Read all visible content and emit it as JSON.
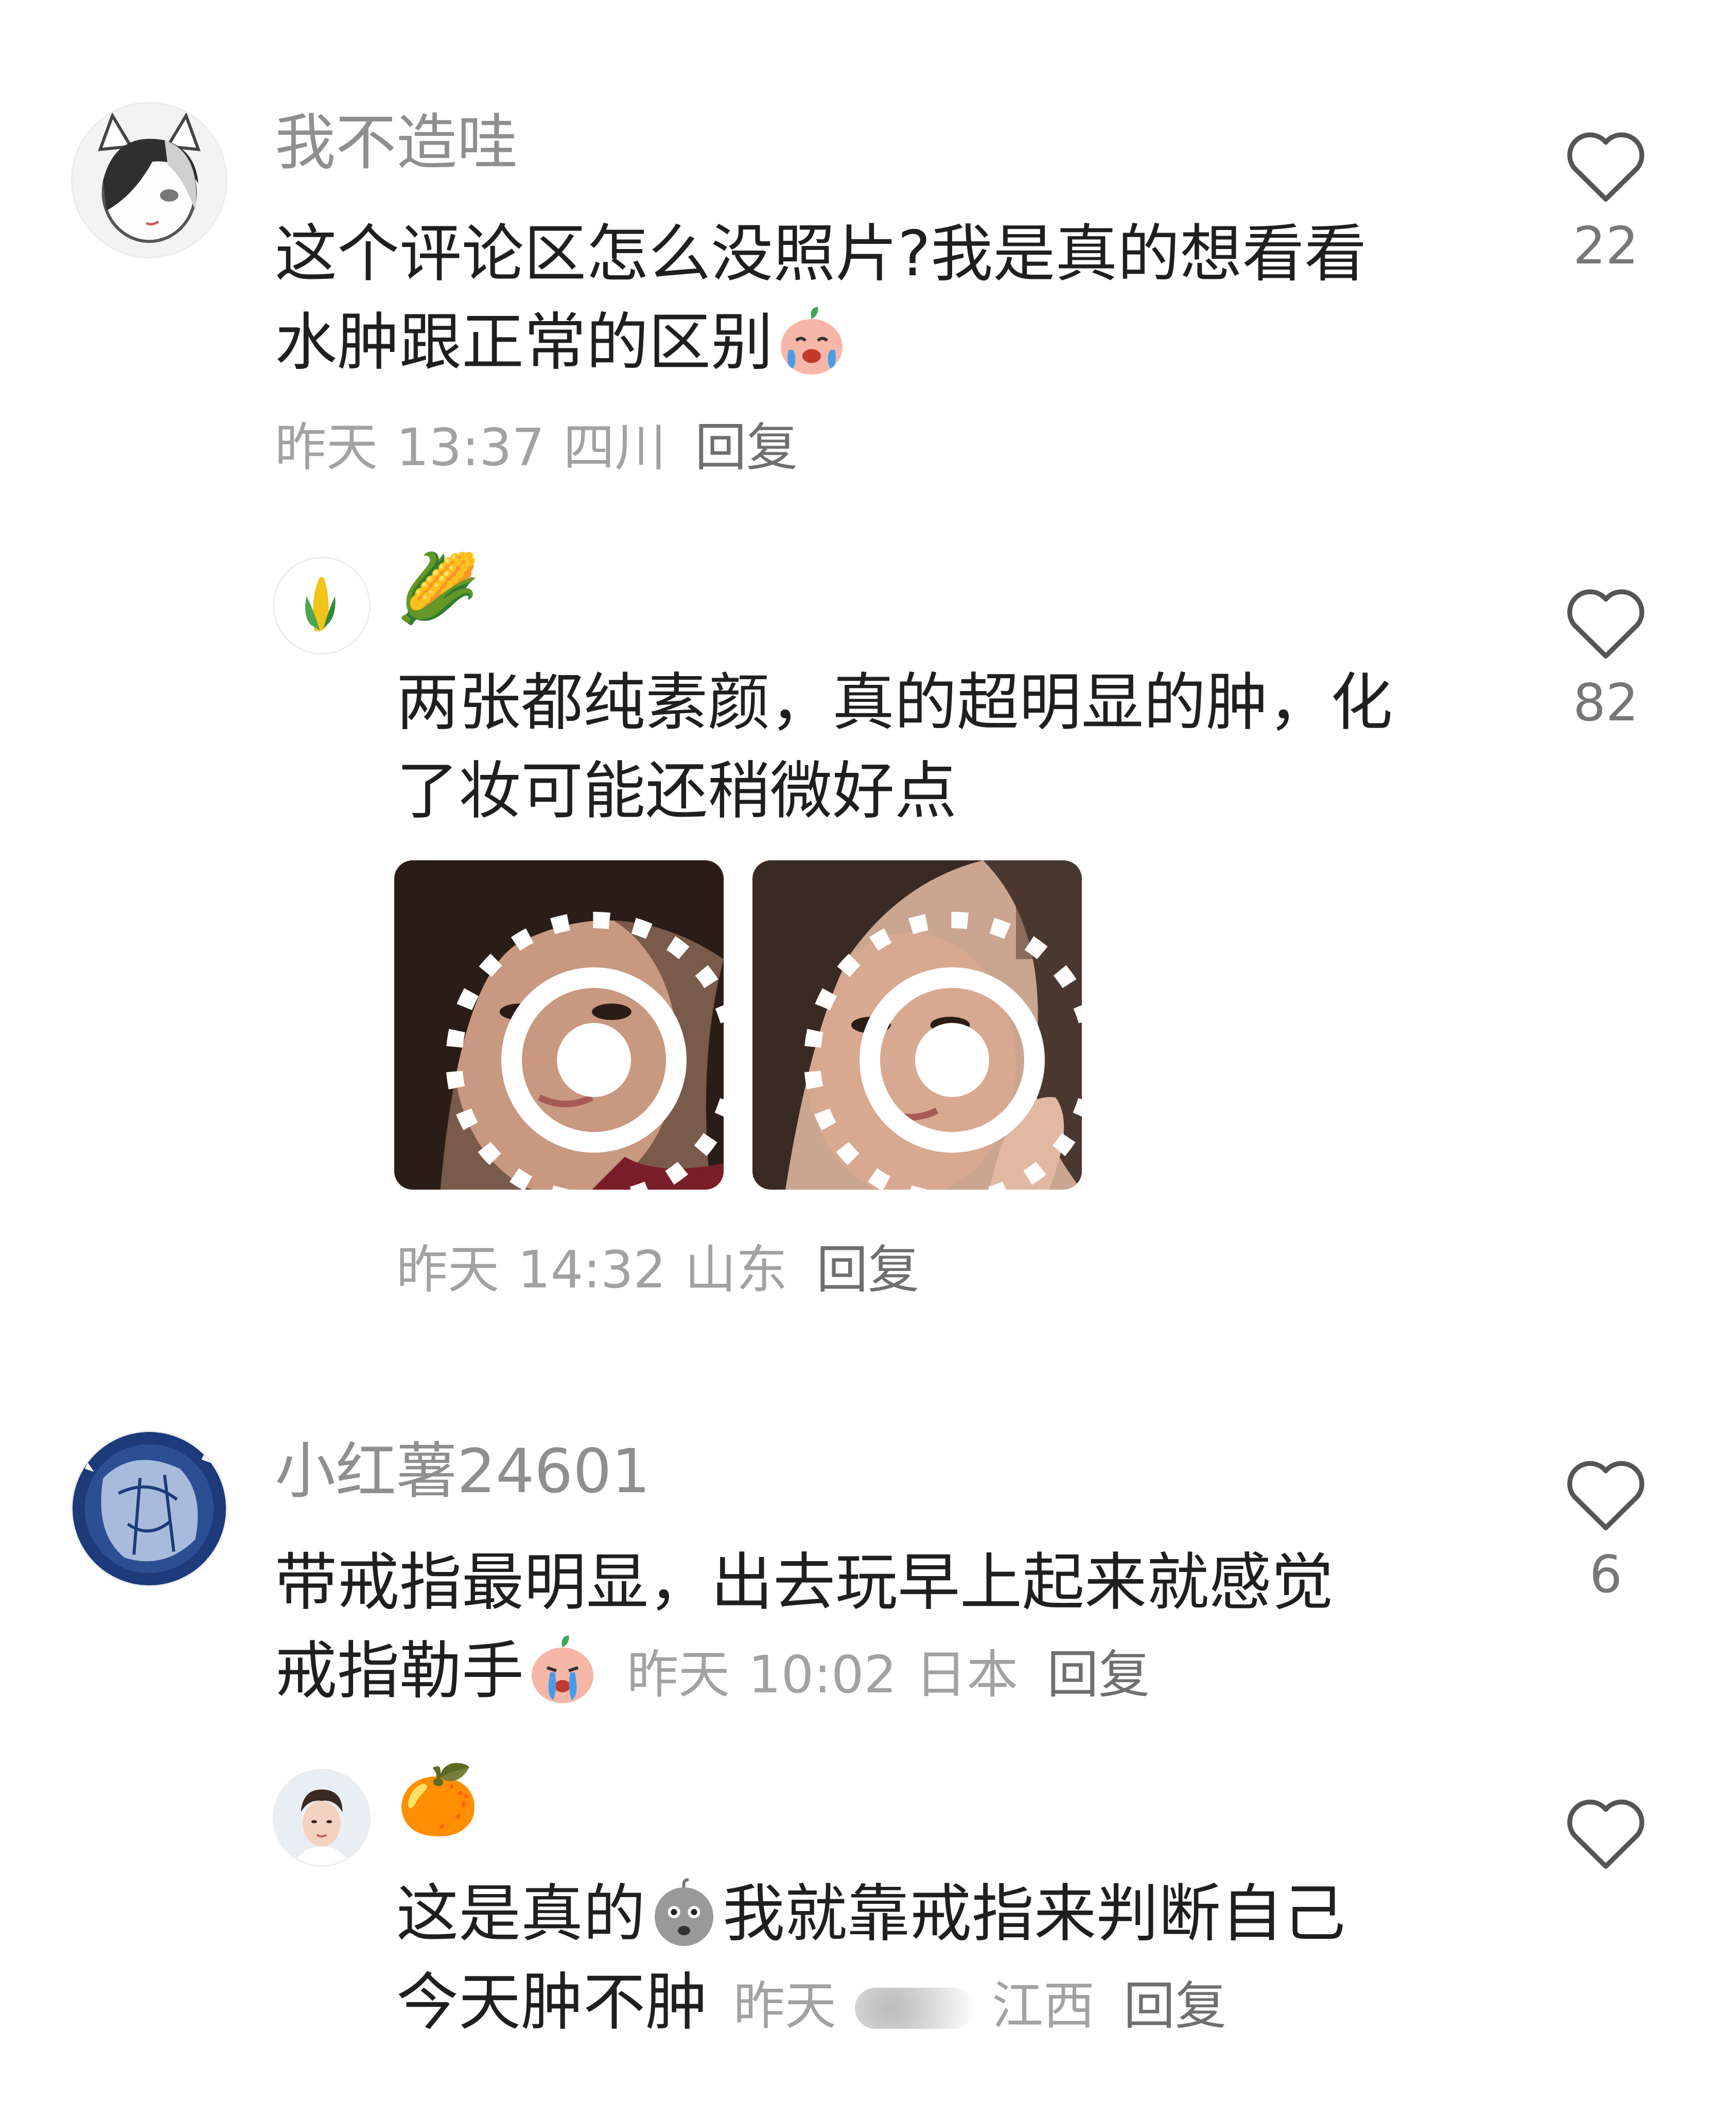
{
  "comments": [
    {
      "username": "我不造哇",
      "text_lines": [
        "这个评论区怎么没照片?我是真的想看看",
        "水肿跟正常的区别"
      ],
      "emoji": "crying-laughing-peach-emoji",
      "date": "昨天",
      "time": "13:37",
      "location": "四川",
      "reply_label": "回复",
      "likes": "22",
      "reply": {
        "username_emoji": "🌽",
        "text_lines": [
          "两张都纯素颜，真的超明显的肿，化",
          "了妆可能还稍微好点"
        ],
        "photos": [
          "photo-1",
          "photo-2"
        ],
        "date": "昨天",
        "time": "14:32",
        "location": "山东",
        "reply_label": "回复",
        "likes": "82"
      }
    },
    {
      "username": "小红薯24601",
      "text_lines": [
        "带戒指最明显，出去玩早上起来就感觉",
        "戒指勒手"
      ],
      "emoji": "crying-peach-emoji",
      "date": "昨天",
      "time": "10:02",
      "location": "日本",
      "reply_label": "回复",
      "likes": "6",
      "reply": {
        "username_emoji": "🍊",
        "text_part1": "这是真的",
        "text_part2": "我就靠戒指来判断自己",
        "text_line2": "今天肿不肿",
        "emoji": "shocked-grey-emoji",
        "date": "昨天",
        "location": "江西",
        "reply_label": "回复"
      }
    }
  ],
  "colors": {
    "username": "#8f8f8f",
    "text": "#1f1f1f",
    "meta": "#a2a2a2",
    "heart": "#555555"
  }
}
